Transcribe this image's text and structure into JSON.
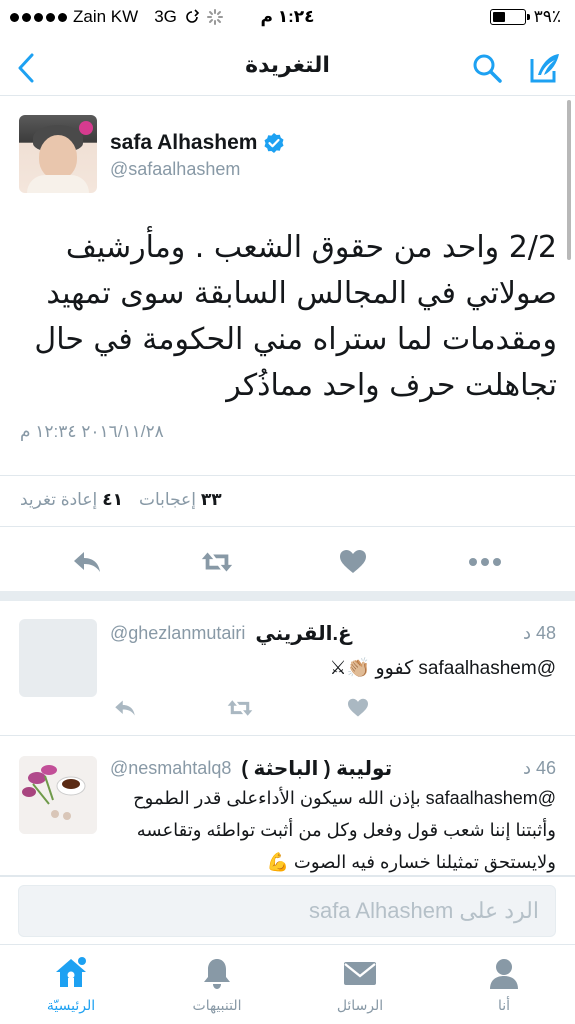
{
  "status_bar": {
    "carrier": "Zain KW",
    "network": "3G",
    "time": "١:٢٤ م",
    "battery_percent": "٣٩٪",
    "battery_level": 0.39
  },
  "nav": {
    "title": "التغريدة",
    "icons": [
      "chevron-left-icon",
      "search-icon",
      "compose-icon"
    ]
  },
  "tweet": {
    "author_name": "safa Alhashem",
    "author_handle": "@safaalhashem",
    "verified": true,
    "text": "2/2 واحد من حقوق الشعب . ومأرشيف صولاتي في المجالس السابقة سوى تمهيد ومقدمات لما ستراه مني الحكومة في حال تجاهلت حرف واحد مماذُكر",
    "timestamp": "٢٠١٦/١١/٢٨ ١٢:٣٤ م",
    "likes_count": "٣٣",
    "likes_label": "إعجابات",
    "retweets_count": "٤١",
    "retweets_label": "إعادة تغريد"
  },
  "replies": [
    {
      "name": "غ.القريني",
      "handle": "@ghezlanmutairi",
      "time": "48 د",
      "text": "@safaalhashem كفوو 👏🏼⚔"
    },
    {
      "name": "توليبة ( الباحثة )",
      "handle": "@nesmahtalq8",
      "time": "46 د",
      "text": "@safaalhashem بإذن الله سيكون الأداءعلى قدر الطموح وأثبتنا إننا شعب قول وفعل وكل من أثبت تواطئه وتقاعسه ولايستحق تمثيلنا خساره فيه الصوت 💪"
    }
  ],
  "reply_bar": {
    "placeholder": "الرد على safa Alhashem"
  },
  "tabs": [
    {
      "label": "الرئيسيّة",
      "icon": "home-icon",
      "active": true
    },
    {
      "label": "التنبيهات",
      "icon": "bell-icon",
      "active": false
    },
    {
      "label": "الرسائل",
      "icon": "envelope-icon",
      "active": false
    },
    {
      "label": "أنا",
      "icon": "person-icon",
      "active": false
    }
  ],
  "colors": {
    "accent": "#1da1f2",
    "muted": "#8899a6",
    "text": "#14171a",
    "divider": "#e1e8ed"
  }
}
